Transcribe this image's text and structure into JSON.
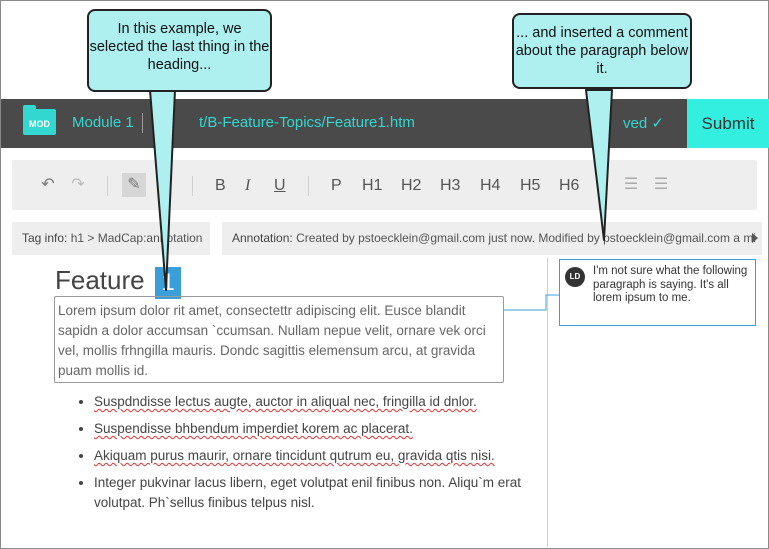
{
  "header": {
    "logo_text": "MOD",
    "module": "Module 1",
    "path": "t/B-Feature-Topics/Feature1.htm",
    "saved": "ved ✓",
    "submit": "Submit"
  },
  "toolbar": {
    "undo": "↶",
    "redo": "↷",
    "highlighter": "✎",
    "bold": "B",
    "italic": "I",
    "underline": "U",
    "p": "P",
    "h1": "H1",
    "h2": "H2",
    "h3": "H3",
    "h4": "H4",
    "h5": "H5",
    "h6": "H6",
    "ordered_list": "☰",
    "unordered_list": "☰"
  },
  "tag_info": {
    "label": "Tag info:",
    "value": "h1 > MadCap:annotation"
  },
  "annotation_info": {
    "label": "Annotation:",
    "created": "Created by pstoecklein@gmail.com just now.",
    "modified": "Modified by pstoecklein@gmail.com a mi"
  },
  "document": {
    "heading": "Feature",
    "marker": "1",
    "paragraph": "Lorem ipsum dolor rit amet, consectettr adipiscing elit. Eusce blandit sapidn a dolor accumsan `ccumsan. Nullam nepue velit, ornare vek orci vel, mollis frhngilla mauris. Dondc sagittis elemensum arcu, at gravida puam mollis id.",
    "bullets": [
      "Suspdndisse lectus augte, auctor in aliqual nec, fringilla id dnlor.",
      "Suspendisse bhbendum imperdiet korem ac placerat.",
      "Akiquam purus maurir, ornare tincidunt qutrum eu, gravida qtis nisi.",
      "Integer pukvinar lacus libern, eget volutpat enil finibus non. Aliqu`m erat volutpat. Ph`sellus finibus telpus nisl."
    ]
  },
  "comment": {
    "initials": "LD",
    "text": "I'm not sure what the following paragraph is saying. It's all lorem ipsum to me."
  },
  "callouts": {
    "left": "In this example, we selected the last thing in the heading...",
    "right": "... and inserted a comment about the paragraph below it."
  },
  "colors": {
    "header_bg": "#4a4a4a",
    "accent": "#32d8d0",
    "submit_bg": "#32efe0",
    "callout_bg": "#aef0f0",
    "marker_bg": "#3a9fd8"
  }
}
